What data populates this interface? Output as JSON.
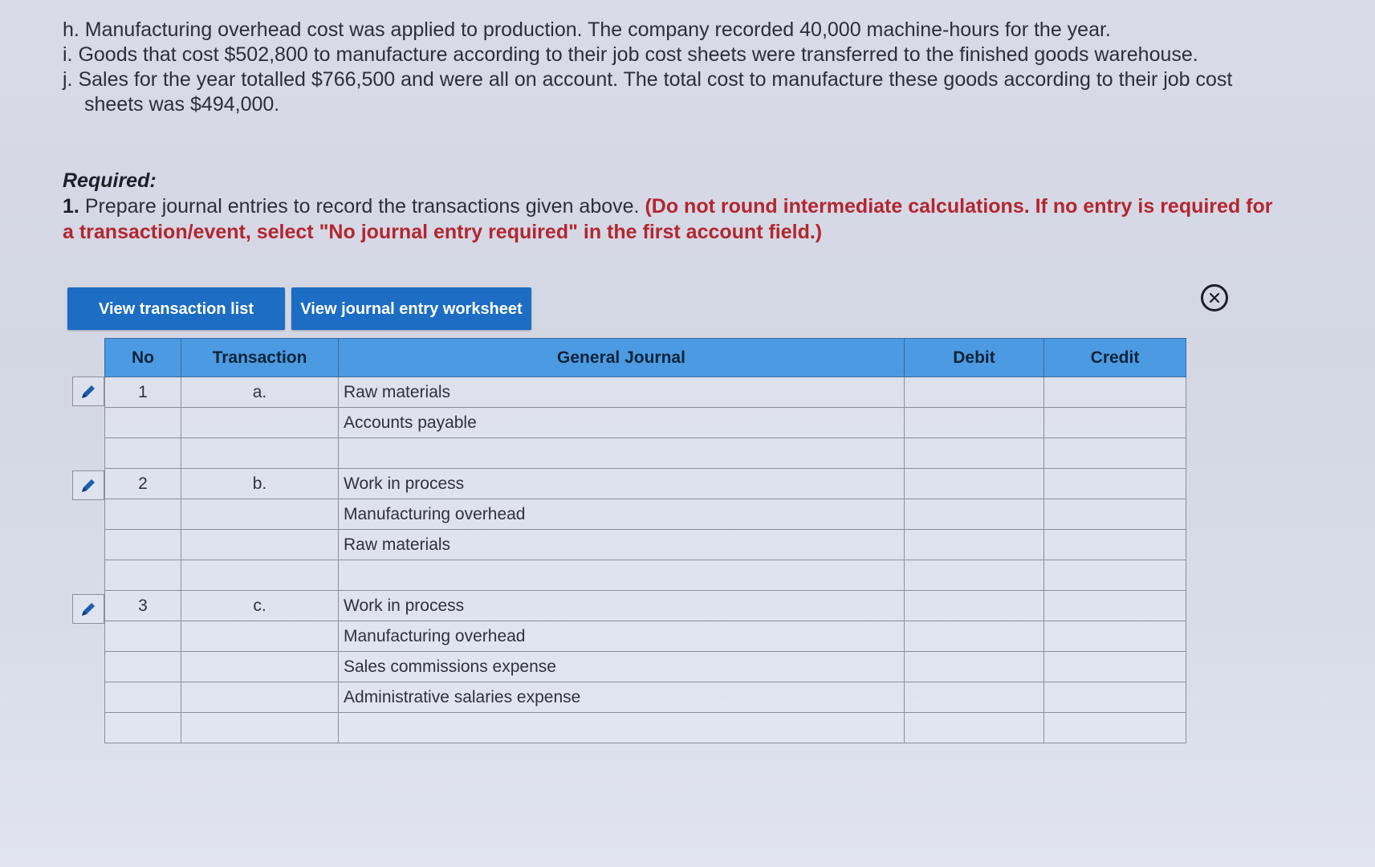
{
  "problem": {
    "h": "h. Manufacturing overhead cost was applied to production. The company recorded 40,000 machine-hours for the year.",
    "i": "i. Goods that cost $502,800 to manufacture according to their job cost sheets were transferred to the finished goods warehouse.",
    "j1": "j. Sales for the year totalled $766,500 and were all on account. The total cost to manufacture these goods according to their job cost",
    "j2": "sheets was $494,000."
  },
  "required": {
    "heading": "Required:",
    "number": "1.",
    "text": "Prepare journal entries to record the transactions given above.",
    "warning_line1": "(Do not round intermediate calculations. If no entry is required for",
    "warning_line2": "a transaction/event, select \"No journal entry required\" in the first account field.)"
  },
  "buttons": {
    "transaction_list": "View transaction list",
    "journal_worksheet": "View journal entry worksheet"
  },
  "table": {
    "headers": {
      "no": "No",
      "transaction": "Transaction",
      "journal": "General Journal",
      "debit": "Debit",
      "credit": "Credit"
    },
    "rows": [
      {
        "no": "1",
        "trans": "a.",
        "account": "Raw materials",
        "debit": "",
        "credit": ""
      },
      {
        "no": "",
        "trans": "",
        "account": "Accounts payable",
        "debit": "",
        "credit": ""
      },
      {
        "no": "",
        "trans": "",
        "account": "",
        "debit": "",
        "credit": ""
      },
      {
        "no": "2",
        "trans": "b.",
        "account": "Work in process",
        "debit": "",
        "credit": ""
      },
      {
        "no": "",
        "trans": "",
        "account": "Manufacturing overhead",
        "debit": "",
        "credit": ""
      },
      {
        "no": "",
        "trans": "",
        "account": "Raw materials",
        "debit": "",
        "credit": ""
      },
      {
        "no": "",
        "trans": "",
        "account": "",
        "debit": "",
        "credit": ""
      },
      {
        "no": "3",
        "trans": "c.",
        "account": "Work in process",
        "debit": "",
        "credit": ""
      },
      {
        "no": "",
        "trans": "",
        "account": "Manufacturing overhead",
        "debit": "",
        "credit": ""
      },
      {
        "no": "",
        "trans": "",
        "account": "Sales commissions expense",
        "debit": "",
        "credit": ""
      },
      {
        "no": "",
        "trans": "",
        "account": "Administrative salaries expense",
        "debit": "",
        "credit": ""
      },
      {
        "no": "",
        "trans": "",
        "account": "",
        "debit": "",
        "credit": ""
      }
    ]
  },
  "icons": {
    "edit": "pencil-icon",
    "close": "close-circle-icon"
  },
  "colors": {
    "button": "#1c6dc3",
    "header": "#4c9be2",
    "warning": "#b3262f",
    "pencil": "#1c5fae"
  }
}
